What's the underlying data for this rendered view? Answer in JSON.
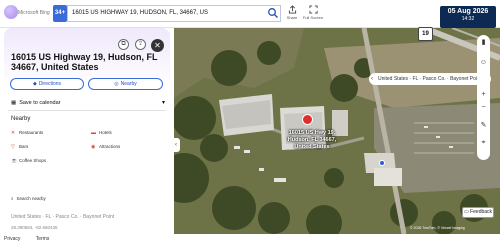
{
  "topbar": {
    "brand": "Microsoft Bing",
    "badge": "34+",
    "search_value": "16015 US HIGHWAY 19, HUDSON, FL, 34667, US",
    "share_label": "Share",
    "fullscreen_label": "Full Screen",
    "date": "05 Aug 2026",
    "time": "14:32"
  },
  "panel": {
    "title": "16015 US Highway 19, Hudson, FL 34667, United States",
    "directions_label": "Directions",
    "nearby_btn_label": "Nearby",
    "save_label": "Save to calendar",
    "nearby_heading": "Nearby",
    "nearby_items": [
      {
        "label": "Restaurants",
        "icon": "fork-knife-icon"
      },
      {
        "label": "Hotels",
        "icon": "bed-icon"
      },
      {
        "label": "Bars",
        "icon": "glass-icon"
      },
      {
        "label": "Attractions",
        "icon": "camera-icon"
      },
      {
        "label": "Coffee Shops",
        "icon": "cup-icon"
      }
    ],
    "search_nearby": "Search nearby",
    "address_line": "United States · FL · Pasco Co. · Bayonet Point",
    "coordinates": "28.390584, -82.660435"
  },
  "footer": {
    "privacy": "Privacy",
    "terms": "Terms"
  },
  "map": {
    "route_shield": "19",
    "location_breadcrumb": "United States · FL · Pasco Co. · Bayonet Point",
    "pin_label": "16015 US Hwy 19, Hudson, FL 34667, United States",
    "feedback": "Feedback",
    "attribution": "© 2026 TomTom, © Vexcel Imaging"
  },
  "colors": {
    "accent": "#3b6bd6",
    "date_bg": "#0d2a55",
    "pin": "#e22d2d"
  }
}
